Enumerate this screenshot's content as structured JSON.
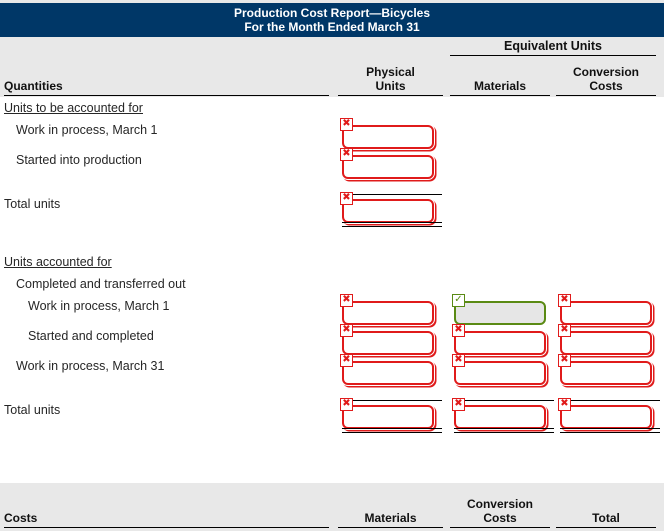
{
  "report": {
    "title_line1": "Production Cost Report—Bicycles",
    "title_line2": "For the Month Ended March 31"
  },
  "quantities_header": {
    "group_label": "Equivalent Units",
    "col_quantities": "Quantities",
    "col_physical": "Physical\nUnits",
    "col_physical_l1": "Physical",
    "col_physical_l2": "Units",
    "col_materials": "Materials",
    "col_conversion_l1": "Conversion",
    "col_conversion_l2": "Costs"
  },
  "sections": [
    {
      "heading": "Units to be accounted for",
      "rows": [
        {
          "label": "Work in process, March 1",
          "indent": 1,
          "cells": [
            {
              "col": "physical",
              "value": "",
              "state": "error",
              "badge": "✖",
              "rule_top": false,
              "rule_double": false
            }
          ]
        },
        {
          "label": "Started into production",
          "indent": 1,
          "cells": [
            {
              "col": "physical",
              "value": "",
              "state": "error",
              "badge": "✖",
              "rule_top": false,
              "rule_double": false
            }
          ]
        },
        {
          "label": "Total units",
          "indent": 0,
          "cells": [
            {
              "col": "physical",
              "value": "",
              "state": "error",
              "badge": "✖",
              "rule_top": true,
              "rule_double": true
            }
          ]
        }
      ]
    },
    {
      "heading": "Units accounted for",
      "subheading": "Completed and transferred out",
      "rows": [
        {
          "label": "Work in process, March 1",
          "indent": 2,
          "cells": [
            {
              "col": "physical",
              "value": "",
              "state": "error",
              "badge": "✖",
              "rule_top": false,
              "rule_double": false
            },
            {
              "col": "materials",
              "value": "",
              "state": "ok",
              "badge": "✓",
              "rule_top": false,
              "rule_double": false
            },
            {
              "col": "conversion",
              "value": "",
              "state": "error",
              "badge": "✖",
              "rule_top": false,
              "rule_double": false
            }
          ]
        },
        {
          "label": "Started and completed",
          "indent": 2,
          "cells": [
            {
              "col": "physical",
              "value": "",
              "state": "error",
              "badge": "✖",
              "rule_top": false,
              "rule_double": false
            },
            {
              "col": "materials",
              "value": "",
              "state": "error",
              "badge": "✖",
              "rule_top": false,
              "rule_double": false
            },
            {
              "col": "conversion",
              "value": "",
              "state": "error",
              "badge": "✖",
              "rule_top": false,
              "rule_double": false
            }
          ]
        },
        {
          "label": "Work in process, March 31",
          "indent": 1,
          "cells": [
            {
              "col": "physical",
              "value": "",
              "state": "error",
              "badge": "✖",
              "rule_top": false,
              "rule_double": false
            },
            {
              "col": "materials",
              "value": "",
              "state": "error",
              "badge": "✖",
              "rule_top": false,
              "rule_double": false
            },
            {
              "col": "conversion",
              "value": "",
              "state": "error",
              "badge": "✖",
              "rule_top": false,
              "rule_double": false
            }
          ]
        },
        {
          "label": "Total units",
          "indent": 0,
          "cells": [
            {
              "col": "physical",
              "value": "",
              "state": "error",
              "badge": "✖",
              "rule_top": true,
              "rule_double": true
            },
            {
              "col": "materials",
              "value": "",
              "state": "error",
              "badge": "✖",
              "rule_top": true,
              "rule_double": true
            },
            {
              "col": "conversion",
              "value": "",
              "state": "error",
              "badge": "✖",
              "rule_top": true,
              "rule_double": true
            }
          ]
        }
      ]
    }
  ],
  "costs_header": {
    "col_costs": "Costs",
    "col_materials": "Materials",
    "col_conversion_l1": "Conversion",
    "col_conversion_l2": "Costs",
    "col_total": "Total"
  },
  "colors": {
    "banner": "#003767",
    "banner_rule": "#00213e",
    "header_bg": "#e8e8e8",
    "error": "#e01b1b",
    "ok": "#5a8a14",
    "ok_fill": "#e6e6e6"
  }
}
